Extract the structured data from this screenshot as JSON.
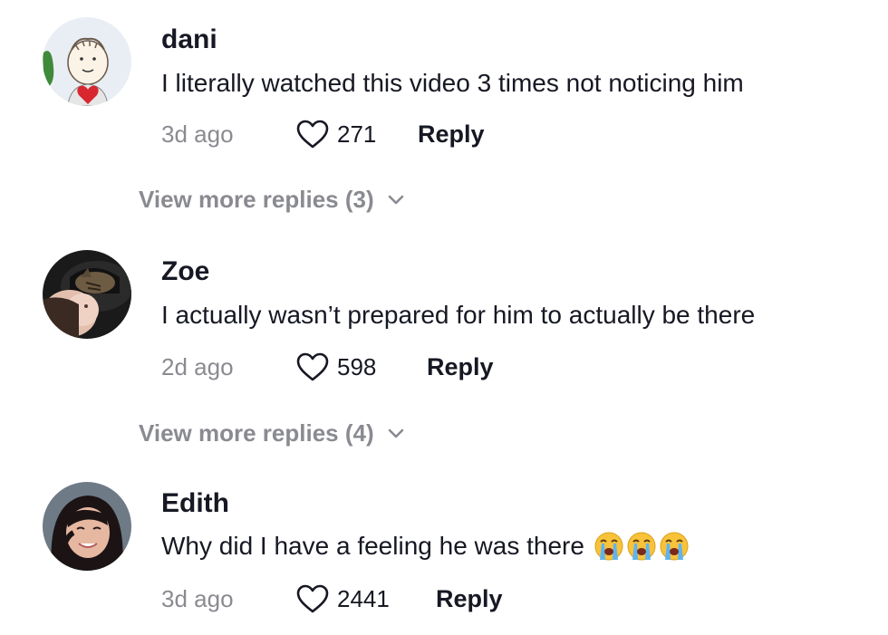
{
  "comments": [
    {
      "username": "dani",
      "text": "I literally watched this video 3 times not noticing him",
      "time": "3d ago",
      "likes": "271",
      "reply_label": "Reply",
      "view_more": "View more replies (3)",
      "avatar_icon": "avatar-cartoon-linus"
    },
    {
      "username": "Zoe",
      "text": "I actually wasn’t prepared for him to actually be there",
      "time": "2d ago",
      "likes": "598",
      "reply_label": "Reply",
      "view_more": "View more replies (4)",
      "avatar_icon": "avatar-photo-cat"
    },
    {
      "username": "Edith",
      "text": "Why did I have a feeling he was there",
      "emojis": [
        "loudly-crying-face-emoji",
        "loudly-crying-face-emoji",
        "loudly-crying-face-emoji"
      ],
      "time": "3d ago",
      "likes": "2441",
      "reply_label": "Reply",
      "avatar_icon": "avatar-photo-person"
    }
  ],
  "icons": {
    "like": "heart-icon",
    "expand": "chevron-down-icon"
  },
  "colors": {
    "text_primary": "#161823",
    "text_secondary": "#8a8b91",
    "background": "#ffffff"
  }
}
